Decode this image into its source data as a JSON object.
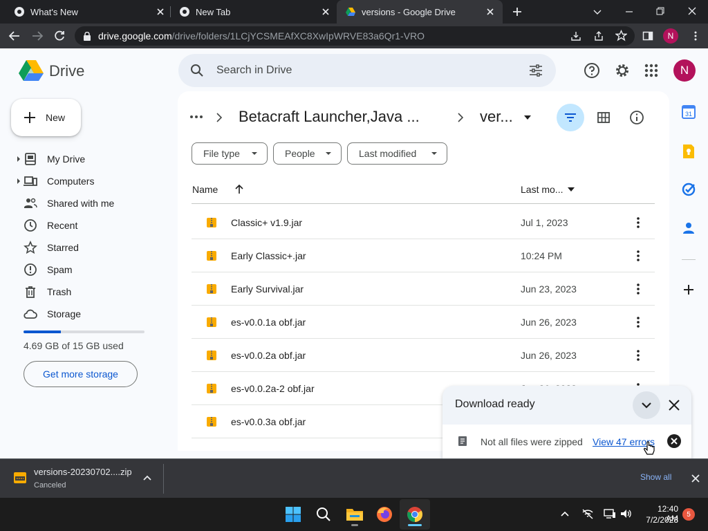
{
  "browser": {
    "tabs": [
      {
        "title": "What's New",
        "active": false
      },
      {
        "title": "New Tab",
        "active": false
      },
      {
        "title": "versions - Google Drive",
        "active": true
      }
    ],
    "url_host": "drive.google.com",
    "url_path": "/drive/folders/1LCjYCSMEAfXC8XwIpWRVE83a6Qr1-VRO",
    "profile_initial": "N"
  },
  "drive": {
    "logo_text": "Drive",
    "search_placeholder": "Search in Drive",
    "account_initial": "N",
    "new_label": "New",
    "nav": [
      {
        "label": "My Drive",
        "icon": "my-drive-icon"
      },
      {
        "label": "Computers",
        "icon": "computers-icon"
      },
      {
        "label": "Shared with me",
        "icon": "shared-icon"
      },
      {
        "label": "Recent",
        "icon": "clock-icon"
      },
      {
        "label": "Starred",
        "icon": "star-icon"
      },
      {
        "label": "Spam",
        "icon": "spam-icon"
      },
      {
        "label": "Trash",
        "icon": "trash-icon"
      },
      {
        "label": "Storage",
        "icon": "cloud-icon"
      }
    ],
    "storage_used_fraction": 0.31,
    "storage_text": "4.69 GB of 15 GB used",
    "get_storage_label": "Get more storage",
    "breadcrumb": {
      "parent": "Betacraft Launcher,Java ...",
      "current": "ver..."
    },
    "filters": [
      "File type",
      "People",
      "Last modified"
    ],
    "columns": {
      "name": "Name",
      "modified": "Last mo..."
    },
    "files": [
      {
        "name": "Classic+ v1.9.jar",
        "modified": "Jul 1, 2023"
      },
      {
        "name": "Early Classic+.jar",
        "modified": "10:24 PM"
      },
      {
        "name": "Early Survival.jar",
        "modified": "Jun 23, 2023"
      },
      {
        "name": "es-v0.0.1a obf.jar",
        "modified": "Jun 26, 2023"
      },
      {
        "name": "es-v0.0.2a obf.jar",
        "modified": "Jun 26, 2023"
      },
      {
        "name": "es-v0.0.2a-2 obf.jar",
        "modified": "Jun 26, 2023"
      },
      {
        "name": "es-v0.0.3a obf.jar",
        "modified": ""
      }
    ]
  },
  "toast": {
    "title": "Download ready",
    "message": "Not all files were zipped",
    "link": "View 47 errors"
  },
  "download_shelf": {
    "file": "versions-20230702....zip",
    "status": "Canceled",
    "show_all": "Show all"
  },
  "taskbar": {
    "time": "12:40 AM",
    "date": "7/2/2023",
    "notifications": "5"
  },
  "colors": {
    "accent": "#0b57d0",
    "avatar": "#b3125b",
    "chrome_dark": "#202124"
  }
}
